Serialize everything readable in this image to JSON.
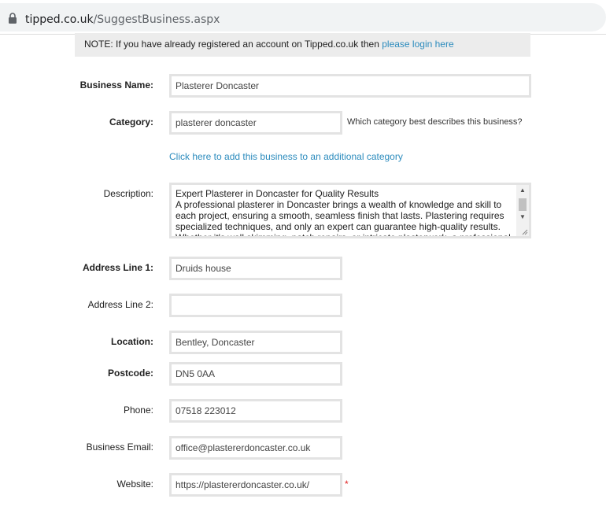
{
  "browser": {
    "url_host": "tipped.co.uk",
    "url_path": "/SuggestBusiness.aspx"
  },
  "note": {
    "text": "NOTE: If you have already registered an account on Tipped.co.uk then ",
    "link": "please login here"
  },
  "form": {
    "business_name": {
      "label": "Business Name:",
      "value": "Plasterer Doncaster"
    },
    "category": {
      "label": "Category:",
      "value": "plasterer doncaster",
      "hint": "Which category best describes this business?"
    },
    "add_category_link": "Click here to add this business to an additional category",
    "description": {
      "label": "Description:",
      "value": "Expert Plasterer in Doncaster for Quality Results\nA professional plasterer in Doncaster brings a wealth of knowledge and skill to each project, ensuring a smooth, seamless finish that lasts. Plastering requires specialized techniques, and only an expert can guarantee high-quality results. Whether it's wall skimming, patch repairs, or intricate plasterwork, a professional"
    },
    "address1": {
      "label": "Address Line 1:",
      "value": "Druids house"
    },
    "address2": {
      "label": "Address Line 2:",
      "value": ""
    },
    "location": {
      "label": "Location:",
      "value": "Bentley, Doncaster"
    },
    "postcode": {
      "label": "Postcode:",
      "value": "DN5 0AA"
    },
    "phone": {
      "label": "Phone:",
      "value": "07518 223012"
    },
    "email": {
      "label": "Business Email:",
      "value": "office@plastererdoncaster.co.uk"
    },
    "website": {
      "label": "Website:",
      "value": "https://plastererdoncaster.co.uk/",
      "required_mark": "*"
    }
  },
  "colors": {
    "link": "#2b8bbd",
    "required": "#e02020",
    "field_border": "#e3e3e3",
    "note_bg": "#ececec"
  },
  "icons": {
    "address_bar": "lock-icon",
    "scroll_up": "scroll-up-arrow-icon",
    "scroll_down": "scroll-down-arrow-icon",
    "resize": "resize-grip-icon"
  }
}
